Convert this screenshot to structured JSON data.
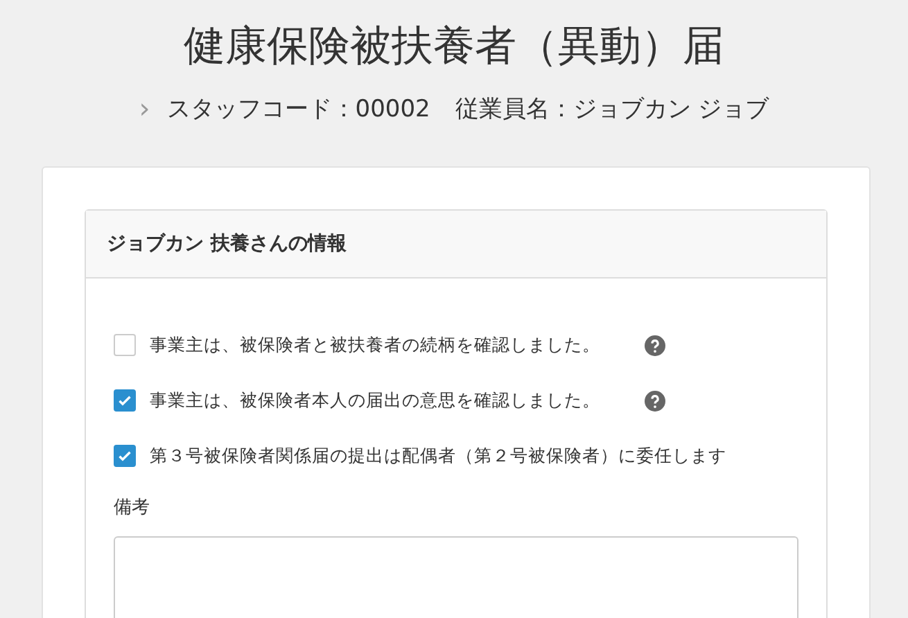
{
  "page_title": "健康保険被扶養者（異動）届",
  "breadcrumb": {
    "separator": "›",
    "items": [
      "スタッフコード：00002",
      "従業員名：ジョブカン ジョブ"
    ]
  },
  "panel": {
    "title": "ジョブカン 扶養さんの情報",
    "checkboxes": [
      {
        "label": "事業主は、被保険者と被扶養者の続柄を確認しました。",
        "checked": false,
        "help": true
      },
      {
        "label": "事業主は、被保険者本人の届出の意思を確認しました。",
        "checked": true,
        "help": true
      },
      {
        "label": "第３号被保険者関係届の提出は配偶者（第２号被保険者）に委任します",
        "checked": true,
        "help": false
      }
    ],
    "remarks": {
      "label": "備考"
    }
  }
}
